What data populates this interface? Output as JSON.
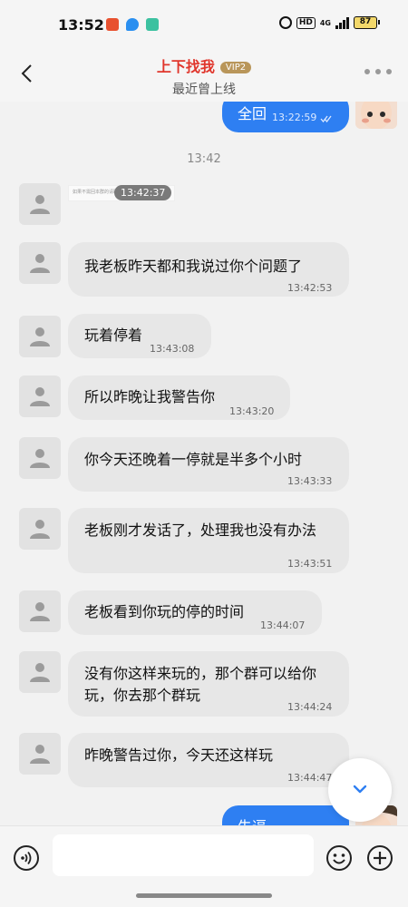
{
  "status_bar": {
    "time": "13:52",
    "hd": "HD",
    "network": "4G",
    "battery": "87"
  },
  "header": {
    "contact_name": "上下找我",
    "vip_badge": "VIP2",
    "status": "最近曾上线"
  },
  "chat": {
    "outgoing_top": {
      "text": "全回",
      "time": "13:22:59"
    },
    "time_divider": "13:42",
    "image_message": {
      "caption": "如果不需回本群的请联系...",
      "time": "13:42:37"
    },
    "messages": [
      {
        "text": "我老板昨天都和我说过你个问题了",
        "time": "13:42:53"
      },
      {
        "text": "玩着停着",
        "time": "13:43:08"
      },
      {
        "text": "所以昨晚让我警告你",
        "time": "13:43:20"
      },
      {
        "text": "你今天还晚着一停就是半多个小时",
        "time": "13:43:33"
      },
      {
        "text": "老板刚才发话了，处理我也没有办法",
        "time": "13:43:51"
      },
      {
        "text": "老板看到你玩的停的时间",
        "time": "13:44:07"
      },
      {
        "text": "没有你这样来玩的，那个群可以给你玩，你去那个群玩",
        "time": "13:44:24"
      },
      {
        "text": "昨晚警告过你，今天还这样玩",
        "time": "13:44:47"
      }
    ],
    "outgoing_bottom": {
      "text": "失逼"
    }
  },
  "composer": {
    "placeholder": ""
  },
  "icons": {
    "back": "back-arrow-icon",
    "more": "more-dots-icon",
    "avatar": "default-person-icon",
    "read": "double-check-icon",
    "scroll": "chevron-down-icon",
    "voice": "voice-wave-icon",
    "emoji": "smiley-icon",
    "plus": "plus-icon"
  },
  "colors": {
    "accent_blue": "#2e7ff2",
    "name_red": "#e0362c",
    "vip_gold": "#b9965a",
    "incoming_bubble": "#e7e7e7"
  }
}
